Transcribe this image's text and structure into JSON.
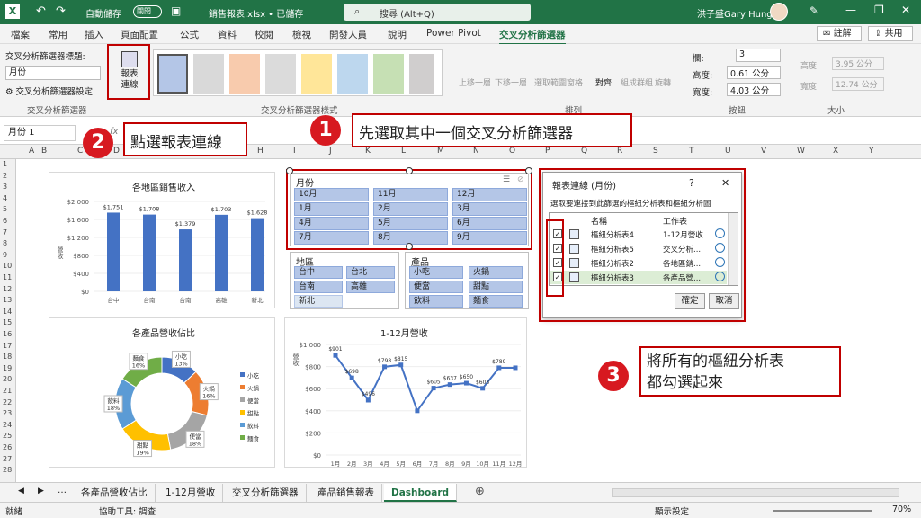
{
  "titlebar": {
    "autosave": "自動儲存",
    "autosave_state": "關閉",
    "filename": "銷售報表.xlsx • 已儲存",
    "search": "搜尋 (Alt+Q)",
    "user": "洪子盛Gary Hung"
  },
  "tabs": [
    "檔案",
    "常用",
    "插入",
    "頁面配置",
    "公式",
    "資料",
    "校閱",
    "檢視",
    "開發人員",
    "說明",
    "Power Pivot",
    "交叉分析篩選器"
  ],
  "tabs_right": {
    "comment": "註解",
    "share": "共用"
  },
  "ribbon": {
    "caption_label": "交叉分析篩選器標題:",
    "caption_value": "月份",
    "settings": "交叉分析篩選器設定",
    "group1": "交叉分析篩選器",
    "report_conn": "報表\n連線",
    "group2": "交叉分析篩選器樣式",
    "bring_fwd": "上移一層",
    "send_back": "下移一層",
    "sel_pane": "選取範圍窗格",
    "align": "對齊",
    "group": "組成群組",
    "rotate": "旋轉",
    "group3": "排列",
    "cols_label": "欄:",
    "cols_value": "3",
    "height_label": "高度:",
    "height_value": "0.61 公分",
    "width_label": "寬度:",
    "width_value": "4.03 公分",
    "group4": "按鈕",
    "h2_label": "高度:",
    "h2_value": "3.95 公分",
    "w2_label": "寬度:",
    "w2_value": "12.74 公分",
    "group5": "大小"
  },
  "formula": {
    "namebox": "月份 1",
    "fx": "fx"
  },
  "columns": [
    "A",
    "B",
    "C",
    "D",
    "E",
    "F",
    "G",
    "H",
    "I",
    "J",
    "K",
    "L",
    "M",
    "N",
    "O",
    "P",
    "Q",
    "R",
    "S",
    "T",
    "U",
    "V",
    "W",
    "X",
    "Y"
  ],
  "rows": [
    "1",
    "2",
    "3",
    "4",
    "5",
    "6",
    "7",
    "8",
    "9",
    "10",
    "11",
    "12",
    "13",
    "14",
    "15",
    "16",
    "17",
    "18",
    "19",
    "20",
    "21",
    "22",
    "23",
    "24",
    "25",
    "26",
    "27",
    "28"
  ],
  "chart1": {
    "title": "各地區銷售收入",
    "ylabel": "營收",
    "yticks": [
      "$2,000",
      "$1,600",
      "$1,200",
      "$800",
      "$400",
      "$0"
    ],
    "categories": [
      "台中",
      "台南",
      "台南",
      "高雄",
      "新北"
    ],
    "values": [
      "$1,751",
      "$1,708",
      "$1,379",
      "$1,703",
      "$1,628"
    ]
  },
  "chart2": {
    "title": "各產品營收佔比",
    "slices": [
      {
        "label": "小吃\n13%"
      },
      {
        "label": "火鍋\n16%"
      },
      {
        "label": "便當\n18%"
      },
      {
        "label": "甜點\n19%"
      },
      {
        "label": "飲料\n18%"
      },
      {
        "label": "麵食\n16%"
      }
    ],
    "legend": [
      "小吃",
      "火鍋",
      "便當",
      "甜點",
      "飲料",
      "麵食"
    ]
  },
  "chart3": {
    "title": "1-12月營收",
    "ylabel": "營收",
    "yticks": [
      "$1,000",
      "$800",
      "$600",
      "$400",
      "$200",
      "$0"
    ],
    "xlabels": [
      "1月",
      "2月",
      "3月",
      "4月",
      "5月",
      "6月",
      "7月",
      "8月",
      "9月",
      "10月",
      "11月",
      "12月"
    ],
    "labels": [
      "$901",
      "$698",
      "$496",
      "$798",
      "$815",
      "$605",
      "$637",
      "$650",
      "$603",
      "$789"
    ]
  },
  "slicer_month": {
    "title": "月份",
    "items": [
      "10月",
      "11月",
      "12月",
      "1月",
      "2月",
      "3月",
      "4月",
      "5月",
      "6月",
      "7月",
      "8月",
      "9月"
    ]
  },
  "slicer_region": {
    "title": "地區",
    "items": [
      "台中",
      "台北",
      "台南",
      "高雄",
      "新北"
    ]
  },
  "slicer_product": {
    "title": "產品",
    "items": [
      "小吃",
      "火鍋",
      "便當",
      "甜點",
      "飲料",
      "麵食"
    ]
  },
  "dialog": {
    "title": "報表連線 (月份)",
    "help": "?",
    "close": "✕",
    "prompt": "選取要連接到此篩選的樞紐分析表和樞紐分析圖",
    "col_name": "名稱",
    "col_sheet": "工作表",
    "rows": [
      {
        "name": "樞紐分析表4",
        "sheet": "1-12月營收"
      },
      {
        "name": "樞紐分析表5",
        "sheet": "交叉分析..."
      },
      {
        "name": "樞紐分析表2",
        "sheet": "各地區銷..."
      },
      {
        "name": "樞紐分析表3",
        "sheet": "各產品營..."
      }
    ],
    "ok": "確定",
    "cancel": "取消"
  },
  "callouts": {
    "c1": "先選取其中一個交叉分析篩選器",
    "n1": "1",
    "c2": "點選報表連線",
    "n2": "2",
    "c3": "將所有的樞紐分析表\n都勾選起來",
    "n3": "3"
  },
  "sheettabs": [
    "各產品營收佔比",
    "1-12月營收",
    "交叉分析篩選器",
    "產品銷售報表",
    "Dashboard"
  ],
  "status": {
    "ready": "就緒",
    "access": "協助工具: 調查",
    "display": "顯示設定",
    "zoom": "70%"
  },
  "colors": {
    "excel_green": "#217346",
    "bar_blue": "#4472c4",
    "red": "#c00000"
  }
}
